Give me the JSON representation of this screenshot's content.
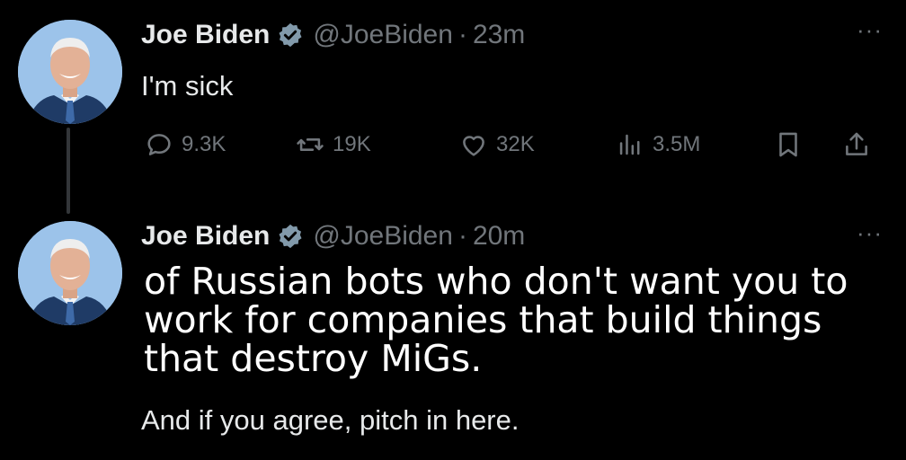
{
  "tweets": [
    {
      "author_name": "Joe Biden",
      "handle": "@JoeBiden",
      "separator": "·",
      "time": "23m",
      "text": "I'm sick",
      "more_label": "···",
      "stats": {
        "replies": "9.3K",
        "retweets": "19K",
        "likes": "32K",
        "views": "3.5M"
      }
    },
    {
      "author_name": "Joe Biden",
      "handle": "@JoeBiden",
      "separator": "·",
      "time": "20m",
      "overlay_caption": "of Russian bots who don't want you to work for companies that build things that destroy MiGs.",
      "text": "And if you agree, pitch in here.",
      "more_label": "···"
    }
  ],
  "colors": {
    "background": "#000000",
    "text_primary": "#e7e9ea",
    "text_secondary": "#71767b",
    "verified_badge": "#829aab",
    "thread_line": "#333639"
  },
  "icons": [
    "avatar-photo",
    "verified-badge-icon",
    "more-icon",
    "reply-icon",
    "retweet-icon",
    "like-icon",
    "views-icon",
    "bookmark-icon",
    "share-icon"
  ]
}
